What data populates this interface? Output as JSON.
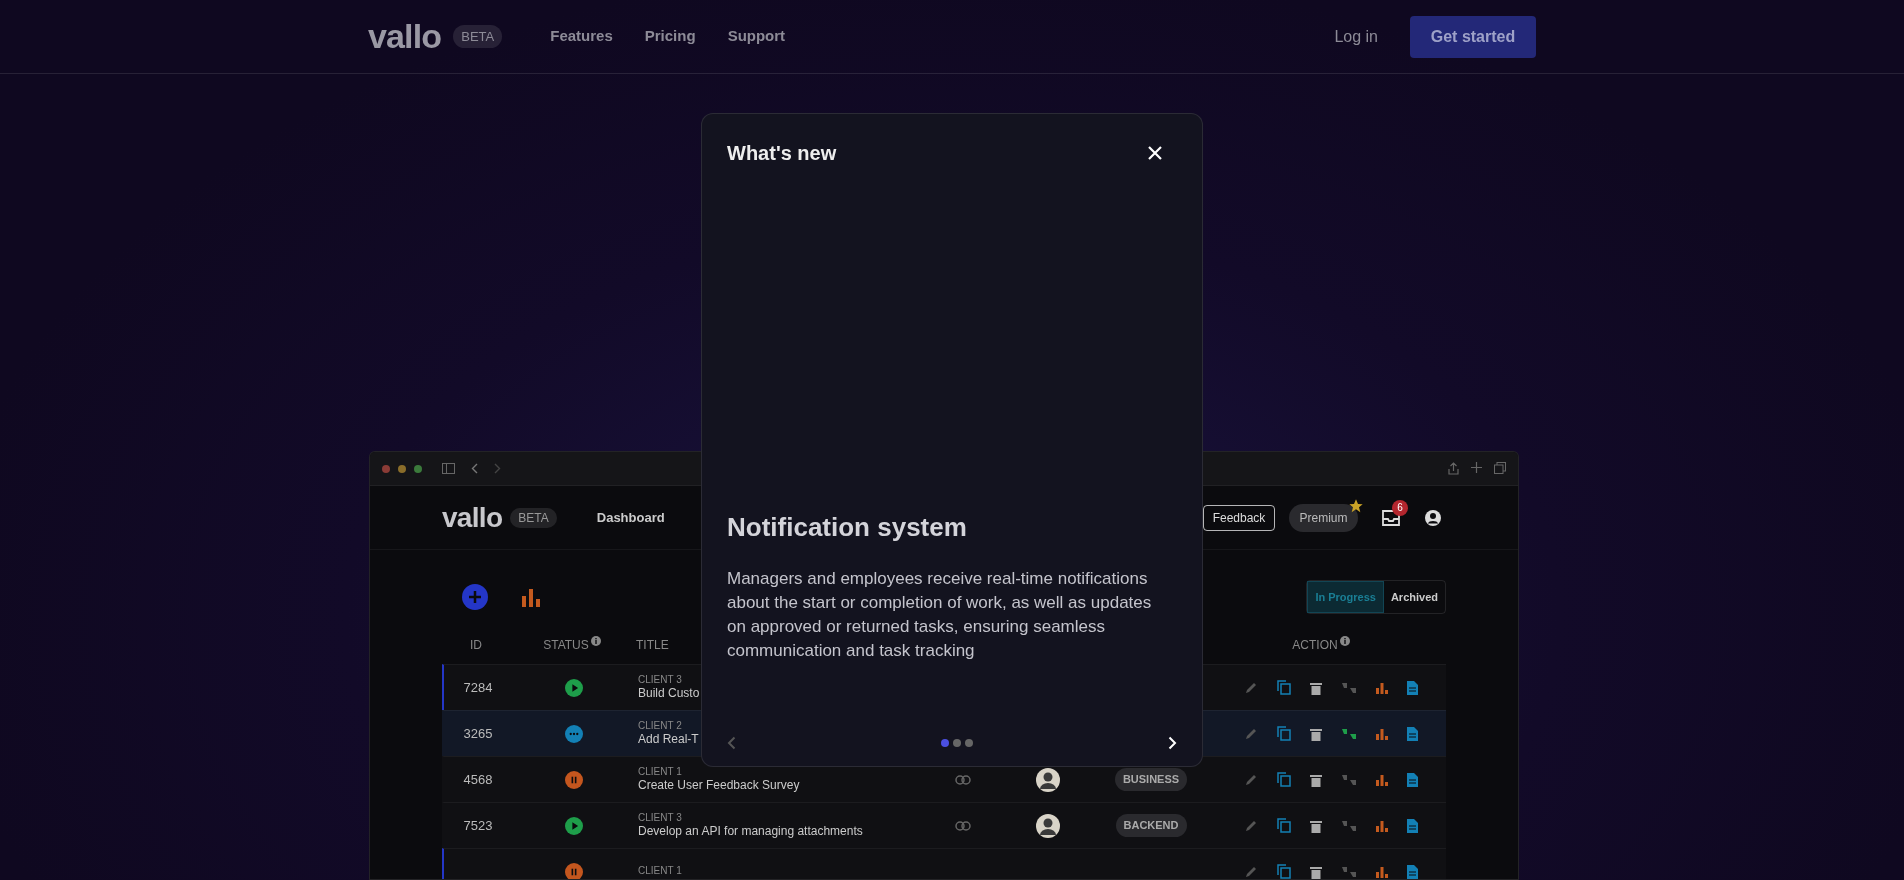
{
  "site_header": {
    "logo": "vallo",
    "badge": "BETA",
    "nav": [
      "Features",
      "Pricing",
      "Support"
    ],
    "login": "Log in",
    "cta": "Get started"
  },
  "app_preview": {
    "header": {
      "logo": "vallo",
      "badge": "BETA",
      "nav": [
        "Dashboard"
      ],
      "feedback": "Feedback",
      "premium": "Premium",
      "inbox_count": "6"
    },
    "filter_tabs": [
      {
        "label": "In Progress",
        "selected": true
      },
      {
        "label": "Archived",
        "selected": false
      }
    ],
    "columns": [
      "ID",
      "STATUS",
      "TITLE",
      "ACTION"
    ],
    "rows": [
      {
        "id": "7284",
        "kind": "running",
        "client": "CLIENT 3",
        "title": "Build Custo",
        "accent": true,
        "selected": false,
        "approved": false
      },
      {
        "id": "3265",
        "kind": "pending",
        "client": "CLIENT 2",
        "title": "Add Real-T",
        "accent": false,
        "selected": true,
        "approved": true
      },
      {
        "id": "4568",
        "kind": "paused",
        "client": "CLIENT 1",
        "title": "Create User Feedback Survey",
        "tag": "BUSINESS",
        "avatar": true,
        "accent": false,
        "selected": false,
        "approved": false
      },
      {
        "id": "7523",
        "kind": "running",
        "client": "CLIENT 3",
        "title": "Develop an API for managing attachments",
        "tag": "BACKEND",
        "avatar": true,
        "accent": false,
        "selected": false,
        "approved": false
      },
      {
        "kind": "paused",
        "client": "CLIENT 1",
        "accent": true,
        "selected": false,
        "approved": false
      }
    ]
  },
  "modal": {
    "title": "What's new",
    "heading": "Notification system",
    "body": "Managers and employees receive real-time notifications about the start or completion of work, as well as updates on approved or returned tasks, ensuring seamless communication and task tracking",
    "pages": [
      {
        "selected": true
      },
      {
        "selected": false
      },
      {
        "selected": false
      }
    ]
  }
}
